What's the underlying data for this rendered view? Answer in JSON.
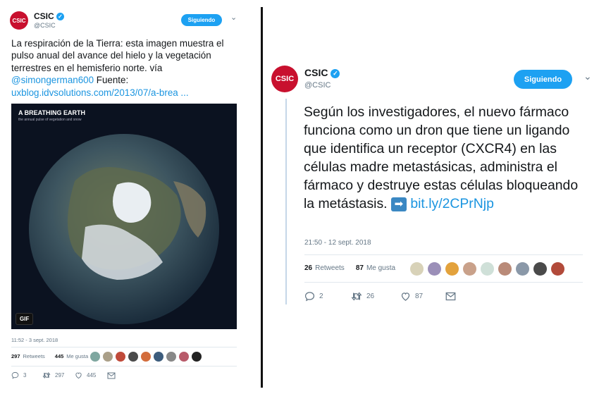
{
  "left": {
    "logo_text": "CSIC",
    "name": "CSIC",
    "handle": "@CSIC",
    "follow_label": "Siguiendo",
    "text_before": "La respiración de la Tierra: esta imagen muestra el pulso anual del avance del hielo y la vegetación terrestres en el hemisferio norte. vía ",
    "mention": "@simongerman600",
    "text_after": " Fuente: ",
    "url": "uxblog.idvsolutions.com/2013/07/a-brea ...",
    "media": {
      "title": "A BREATHING EARTH",
      "subtitle": "the annual pulse of vegetation and snow",
      "gif_badge": "GIF"
    },
    "timestamp": "11:52 - 3 sept. 2018",
    "retweets_count": "297",
    "retweets_label": "Retweets",
    "likes_count": "445",
    "likes_label": "Me gusta",
    "reply_count": "3",
    "retweet_action_count": "297",
    "like_action_count": "445"
  },
  "right": {
    "logo_text": "CSIC",
    "name": "CSIC",
    "handle": "@CSIC",
    "follow_label": "Siguiendo",
    "text": "Según los investigadores, el nuevo fármaco funciona como un dron que tiene un ligando que identifica un receptor (CXCR4) en las células madre metastásicas, administra el fármaco y destruye estas células bloqueando la metástasis.",
    "link": "bit.ly/2CPrNjp",
    "timestamp": "21:50 - 12 sept. 2018",
    "retweets_count": "26",
    "retweets_label": "Retweets",
    "likes_count": "87",
    "likes_label": "Me gusta",
    "reply_count": "2",
    "retweet_action_count": "26",
    "like_action_count": "87"
  },
  "colors": {
    "brand": "#c8102e",
    "accent": "#1da1f2",
    "link": "#1b95e0",
    "muted": "#657786"
  },
  "icons": [
    "verified-icon",
    "chevron-down-icon",
    "reply-icon",
    "retweet-icon",
    "like-icon",
    "message-icon",
    "arrow-right-icon"
  ]
}
